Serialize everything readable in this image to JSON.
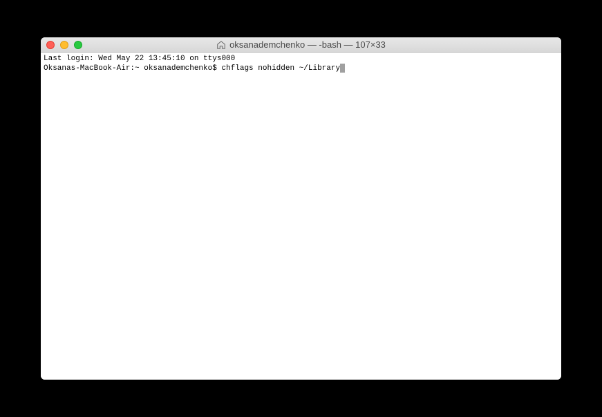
{
  "window": {
    "title": "oksanademchenko — -bash — 107×33"
  },
  "terminal": {
    "line1": "Last login: Wed May 22 13:45:10 on ttys000",
    "prompt": "Oksanas-MacBook-Air:~ oksanademchenko$ ",
    "command": "chflags nohidden ~/Library"
  },
  "colors": {
    "close": "#ff5f57",
    "minimize": "#ffbd2e",
    "maximize": "#28c940"
  }
}
